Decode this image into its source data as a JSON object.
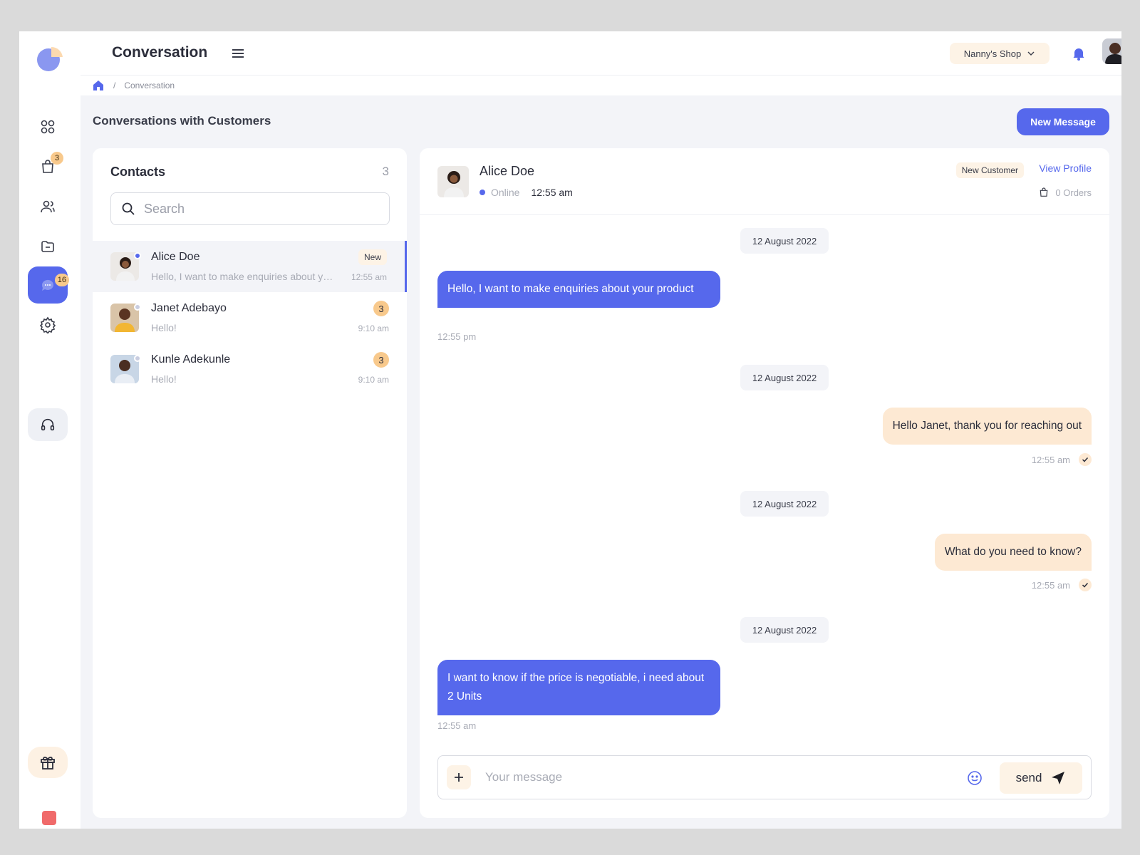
{
  "header": {
    "title": "Conversation",
    "shop_name": "Nanny's Shop"
  },
  "breadcrumb": {
    "current": "Conversation",
    "separator": "/"
  },
  "sidebar": {
    "items": [
      {
        "icon": "dashboard-icon",
        "badge": ""
      },
      {
        "icon": "shopping-bag-icon",
        "badge": "3"
      },
      {
        "icon": "users-icon",
        "badge": ""
      },
      {
        "icon": "folder-icon",
        "badge": ""
      },
      {
        "icon": "chat-icon",
        "badge": "16",
        "active": true
      },
      {
        "icon": "gear-icon",
        "badge": ""
      }
    ]
  },
  "page": {
    "section_title": "Conversations with Customers",
    "new_message_label": "New Message"
  },
  "contacts": {
    "title": "Contacts",
    "count": "3",
    "search_placeholder": "Search",
    "items": [
      {
        "name": "Alice Doe",
        "preview": "Hello, I want to make enquiries about your product",
        "tag": "New",
        "time": "12:55 am",
        "online": true
      },
      {
        "name": "Janet Adebayo",
        "preview": "Hello!",
        "unread": "3",
        "time": "9:10 am",
        "online": false
      },
      {
        "name": "Kunle Adekunle",
        "preview": "Hello!",
        "unread": "3",
        "time": "9:10 am",
        "online": false
      }
    ]
  },
  "chat": {
    "name": "Alice Doe",
    "status": "Online",
    "time": "12:55 am",
    "tag": "New Customer",
    "view_profile": "View Profile",
    "orders": "0 Orders",
    "messages": [
      {
        "date": "12 August 2022",
        "direction": "in",
        "text": "Hello, I want to make enquiries about your product",
        "time": "12:55 pm"
      },
      {
        "date": "12 August 2022",
        "direction": "out",
        "text": "Hello Janet, thank you for reaching out",
        "time": "12:55 am"
      },
      {
        "date": "12 August 2022",
        "direction": "out",
        "text": "What do you need to know?",
        "time": "12:55 am"
      },
      {
        "date": "12 August 2022",
        "direction": "in",
        "text": "I want to know if the price is negotiable, i need about 2 Units",
        "time": "12:55 am"
      }
    ],
    "composer_placeholder": "Your message",
    "send_label": "send"
  },
  "colors": {
    "accent": "#5668ec",
    "peach": "#fde9d3",
    "badge": "#f8c98c"
  }
}
